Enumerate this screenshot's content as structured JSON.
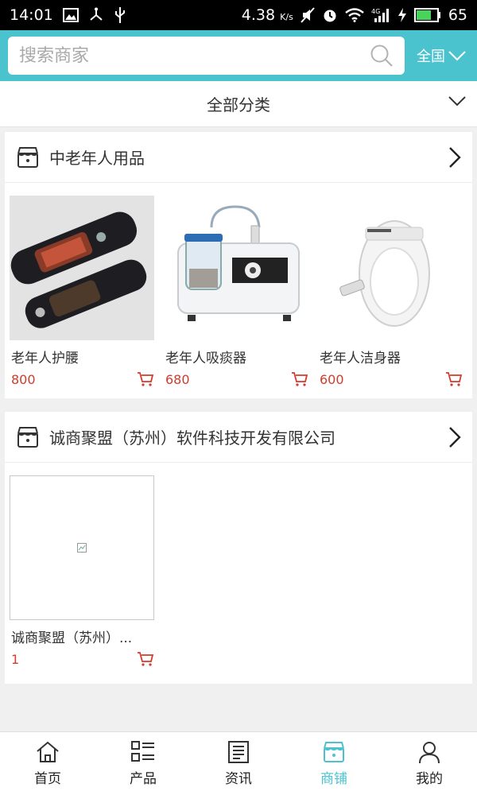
{
  "status_bar": {
    "time": "14:01",
    "speed": "4.38",
    "speed_unit": "K/s",
    "network": "4G",
    "battery": "65"
  },
  "header": {
    "search_placeholder": "搜索商家",
    "region": "全国"
  },
  "category_bar": {
    "label": "全部分类"
  },
  "shops": [
    {
      "name": "中老年人用品",
      "products": [
        {
          "name": "老年人护腰",
          "price": "800",
          "image": "waist-belt"
        },
        {
          "name": "老年人吸痰器",
          "price": "680",
          "image": "suction-machine"
        },
        {
          "name": "老年人洁身器",
          "price": "600",
          "image": "toilet-seat"
        }
      ]
    },
    {
      "name": "诚商聚盟（苏州）软件科技开发有限公司",
      "products": [
        {
          "name": "诚商聚盟（苏州）...",
          "price": "1",
          "image": "broken-image"
        }
      ]
    }
  ],
  "tabs": [
    {
      "label": "首页",
      "icon": "home-icon",
      "active": false
    },
    {
      "label": "产品",
      "icon": "list-icon",
      "active": false
    },
    {
      "label": "资讯",
      "icon": "news-icon",
      "active": false
    },
    {
      "label": "商铺",
      "icon": "store-icon",
      "active": true
    },
    {
      "label": "我的",
      "icon": "user-icon",
      "active": false
    }
  ],
  "colors": {
    "accent": "#4bc3cf",
    "price": "#d33b2c"
  }
}
